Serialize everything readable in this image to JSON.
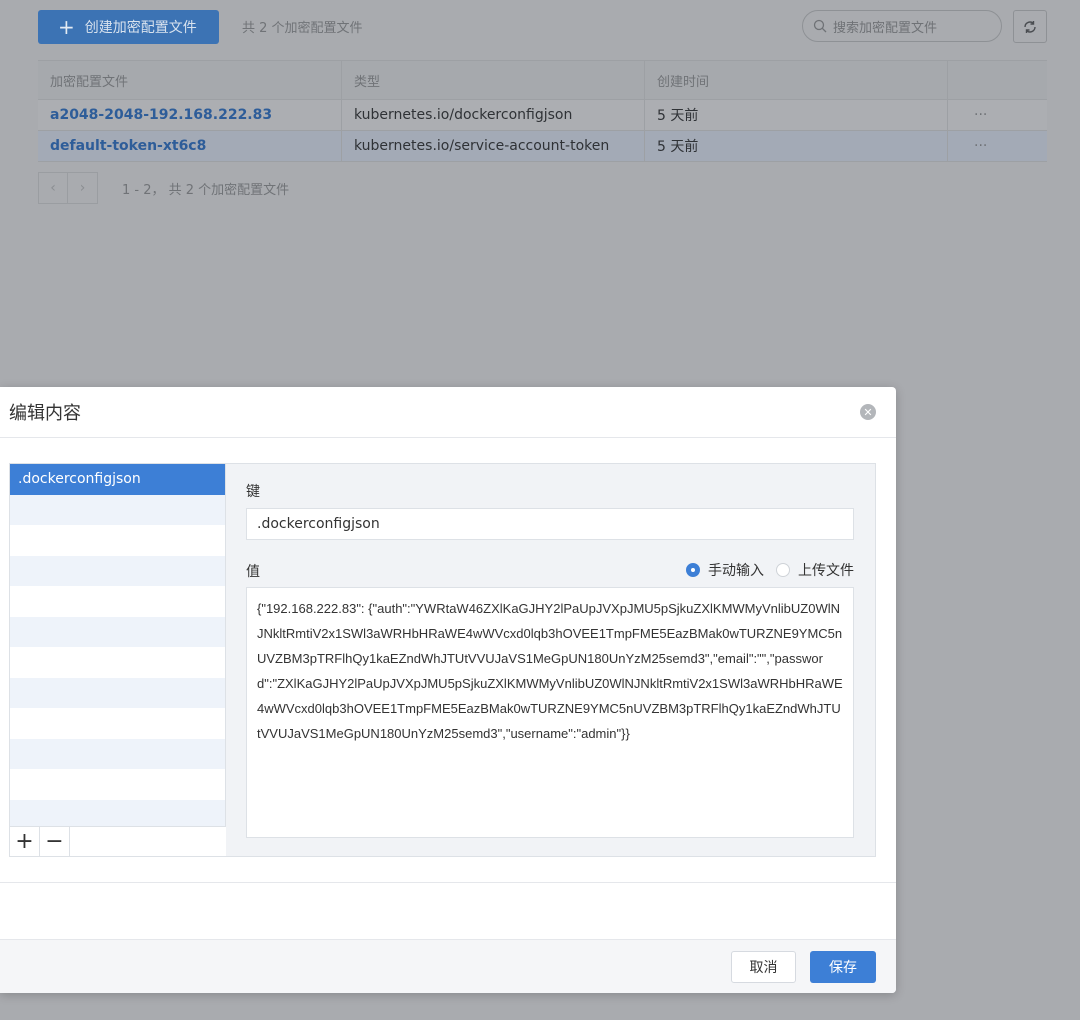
{
  "toolbar": {
    "create_label": "创建加密配置文件",
    "count_text": "共 2 个加密配置文件",
    "search_placeholder": "搜索加密配置文件"
  },
  "table": {
    "headers": [
      "加密配置文件",
      "类型",
      "创建时间"
    ],
    "rows": [
      {
        "name": "a2048-2048-192.168.222.83",
        "type": "kubernetes.io/dockerconfigjson",
        "created": "5 天前",
        "more": "···"
      },
      {
        "name": "default-token-xt6c8",
        "type": "kubernetes.io/service-account-token",
        "created": "5 天前",
        "more": "···"
      }
    ]
  },
  "pager": {
    "prev": "‹",
    "next": "›",
    "text": "1 - 2， 共 2 个加密配置文件"
  },
  "modal": {
    "title": "编辑内容",
    "keys": [
      ".dockerconfigjson"
    ],
    "key_label": "键",
    "key_value": ".dockerconfigjson",
    "value_label": "值",
    "radio_manual": "手动输入",
    "radio_upload": "上传文件",
    "value_text": "{\"192.168.222.83\":\n{\"auth\":\"YWRtaW46ZXlKaGJHY2lPaUpJVXpJMU5pSjkuZXlKMWMyVnlibUZ0WlNJNkltRmtiV2x1SWl3aWRHbHRaWE4wWVcxd0lqb3hOVEE1TmpFME5EazBMak0wTURZNE9YMC5nUVZBM3pTRFlhQy1kaEZndWhJTUtVVUJaVS1MeGpUN180UnYzM25semd3\",\"email\":\"\",\"password\":\"ZXlKaGJHY2lPaUpJVXpJMU5pSjkuZXlKMWMyVnlibUZ0WlNJNkltRmtiV2x1SWl3aWRHbHRaWE4wWVcxd0lqb3hOVEE1TmpFME5EazBMak0wTURZNE9YMC5nUVZBM3pTRFlhQy1kaEZndWhJTUtVVUJaVS1MeGpUN180UnYzM25semd3\",\"username\":\"admin\"}}",
    "add_icon": "+",
    "remove_icon": "−",
    "cancel_label": "取消",
    "save_label": "保存"
  }
}
